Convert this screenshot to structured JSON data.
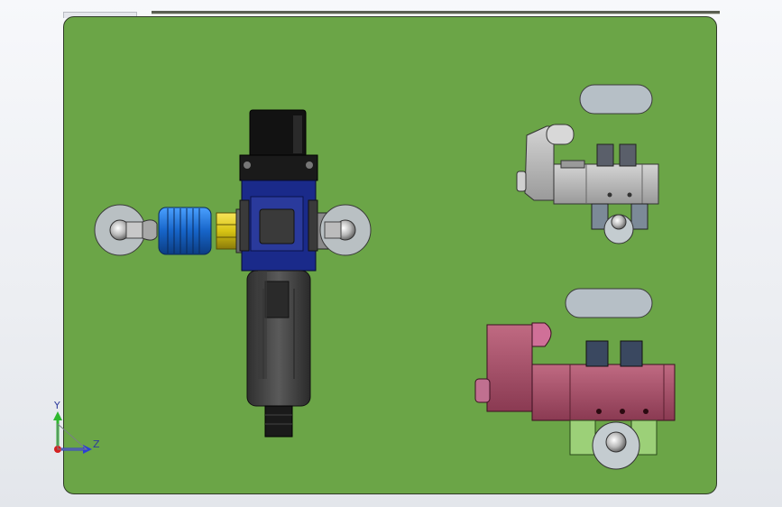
{
  "view": {
    "background": "#eceef2",
    "plate_color": "#6ba547",
    "part_colors": {
      "regulator_body": "#1a2a8a",
      "regulator_cap": "#161616",
      "bowl": "#4a4a4a",
      "muffler": "#1664c8",
      "brass_nut": "#d8c414",
      "valve_top": "#b8b8b8",
      "valve_bottom": "#b0506c",
      "fitting_green": "#9cd078"
    }
  },
  "triad": {
    "y_label": "Y",
    "z_label": "Z",
    "y_color": "#2fb82f",
    "z_color": "#2c3fd4",
    "x_color": "#d42020"
  },
  "components": [
    {
      "name": "filter-regulator"
    },
    {
      "name": "muffler-left"
    },
    {
      "name": "fitting-right"
    },
    {
      "name": "solenoid-valve-top"
    },
    {
      "name": "solenoid-valve-bottom"
    }
  ]
}
